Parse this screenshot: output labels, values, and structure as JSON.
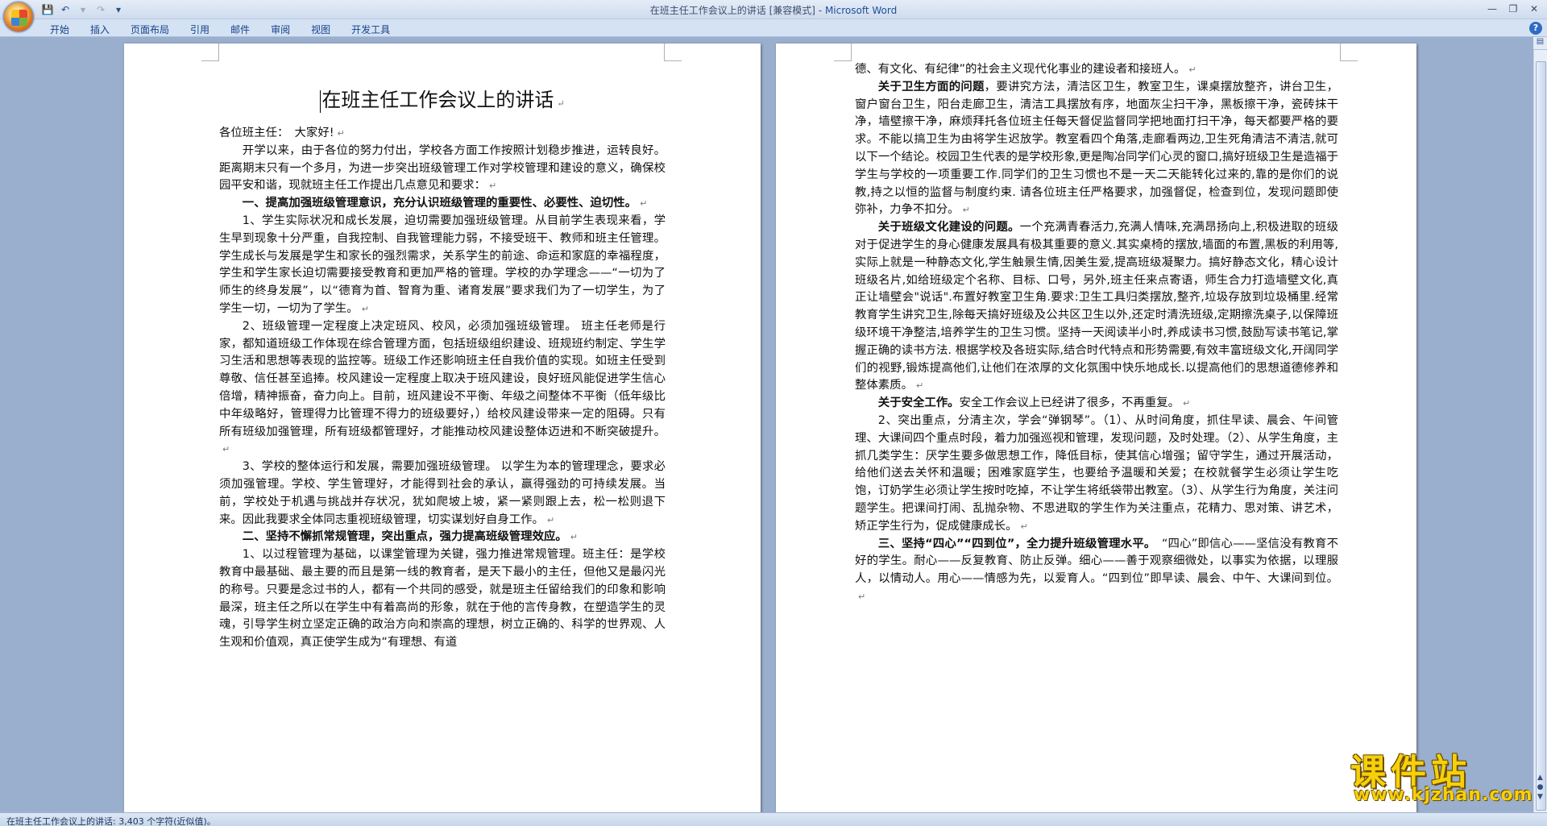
{
  "window": {
    "title_doc": "在班主任工作会议上的讲话 [兼容模式]",
    "title_sep": " - ",
    "title_app": "Microsoft Word"
  },
  "quick_access": {
    "icons": [
      "save-icon",
      "undo-icon",
      "redo-icon",
      "customize-icon"
    ]
  },
  "ribbon": {
    "tabs": [
      "开始",
      "插入",
      "页面布局",
      "引用",
      "邮件",
      "审阅",
      "视图",
      "开发工具"
    ]
  },
  "document": {
    "title": "在班主任工作会议上的讲话",
    "left_page": [
      {
        "type": "plain",
        "text": "各位班主任：　大家好!"
      },
      {
        "type": "ind",
        "text": "开学以来，由于各位的努力付出，学校各方面工作按照计划稳步推进，运转良好。距离期末只有一个多月，为进一步突出班级管理工作对学校管理和建设的意义，确保校园平安和谐，现就班主任工作提出几点意见和要求："
      },
      {
        "type": "ind",
        "bold": true,
        "text": "一、提高加强班级管理意识，充分认识班级管理的重要性、必要性、迫切性。"
      },
      {
        "type": "ind",
        "text": "1、学生实际状况和成长发展，迫切需要加强班级管理。从目前学生表现来看，学生早到现象十分严重，自我控制、自我管理能力弱，不接受班干、教师和班主任管理。学生成长与发展是学生和家长的强烈需求，关系学生的前途、命运和家庭的幸福程度，学生和学生家长迫切需要接受教育和更加严格的管理。学校的办学理念——“一切为了师生的终身发展”，以“德育为首、智育为重、诸育发展”要求我们为了一切学生，为了学生一切，一切为了学生。"
      },
      {
        "type": "ind",
        "text": "2、班级管理一定程度上决定班风、校风，必须加强班级管理。 班主任老师是行家，都知道班级工作体现在综合管理方面，包括班级组织建设、班规班约制定、学生学习生活和思想等表现的监控等。班级工作还影响班主任自我价值的实现。如班主任受到尊敬、信任甚至追捧。校风建设一定程度上取决于班风建设，良好班风能促进学生信心倍增，精神振奋，奋力向上。目前，班风建设不平衡、年级之间整体不平衡（低年级比中年级略好，管理得力比管理不得力的班级要好，）给校风建设带来一定的阻碍。只有所有班级加强管理，所有班级都管理好，才能推动校风建设整体迈进和不断突破提升。"
      },
      {
        "type": "ind",
        "text": "3、学校的整体运行和发展，需要加强班级管理。 以学生为本的管理理念，要求必须加强管理。学校、学生管理好，才能得到社会的承认，赢得强劲的可持续发展。当前，学校处于机遇与挑战并存状况，犹如爬坡上坡，紧一紧则跟上去，松一松则退下来。因此我要求全体同志重视班级管理，切实谋划好自身工作。"
      },
      {
        "type": "ind",
        "bold": true,
        "text": "二、坚持不懈抓常规管理，突出重点，强力提高班级管理效应。"
      },
      {
        "type": "ind",
        "nomark": true,
        "text": "1、以过程管理为基础，以课堂管理为关键，强力推进常规管理。班主任：是学校教育中最基础、最主要的而且是第一线的教育者，是天下最小的主任，但他又是最闪光的称号。只要是念过书的人，都有一个共同的感受，就是班主任留给我们的印象和影响最深，班主任之所以在学生中有着高尚的形象，就在于他的言传身教，在塑造学生的灵魂，引导学生树立坚定正确的政治方向和崇高的理想，树立正确的、科学的世界观、人生观和价值观，真正使学生成为“有理想、有道"
      }
    ],
    "right_page": [
      {
        "type": "plain",
        "text": "德、有文化、有纪律”的社会主义现代化事业的建设者和接班人。"
      },
      {
        "type": "ind",
        "lead": "关于卫生方面的问题",
        "text": "，要讲究方法，清洁区卫生，教室卫生，课桌摆放整齐，讲台卫生，窗户窗台卫生，阳台走廊卫生，清洁工具摆放有序，地面灰尘扫干净，黑板擦干净，瓷砖抹干净，墙壁擦干净，麻烦拜托各位班主任每天督促监督同学把地面打扫干净，每天都要严格的要求。不能以搞卫生为由将学生迟放学。教室看四个角落,走廊看两边,卫生死角清洁不清洁,就可以下一个结论。校园卫生代表的是学校形象,更是陶冶同学们心灵的窗口,搞好班级卫生是造福于学生与学校的一项重要工作.同学们的卫生习惯也不是一天二天能转化过来的,靠的是你们的说教,持之以恒的监督与制度约束. 请各位班主任严格要求，加强督促，检查到位，发现问题即使弥补，力争不扣分。"
      },
      {
        "type": "ind",
        "lead": "关于班级文化建设的问题。",
        "text": "一个充满青春活力,充满人情味,充满昂扬向上,积极进取的班级对于促进学生的身心健康发展具有极其重要的意义.其实桌椅的摆放,墙面的布置,黑板的利用等,实际上就是一种静态文化,学生触景生情,因美生爱,提高班级凝聚力。搞好静态文化，精心设计班级名片,如给班级定个名称、目标、口号，另外,班主任来点寄语，师生合力打造墙壁文化,真正让墙壁会\"说话\".布置好教室卫生角.要求:卫生工具归类摆放,整齐,垃圾存放到垃圾桶里.经常教育学生讲究卫生,除每天搞好班级及公共区卫生以外,还定时清洗班级,定期擦洗桌子,以保障班级环境干净整洁,培养学生的卫生习惯。坚持一天阅读半小时,养成读书习惯,鼓励写读书笔记,掌握正确的读书方法. 根据学校及各班实际,结合时代特点和形势需要,有效丰富班级文化,开阔同学们的视野,锻炼提高他们,让他们在浓厚的文化氛围中快乐地成长.以提高他们的思想道德修养和整体素质。"
      },
      {
        "type": "ind",
        "lead": "关于安全工作。",
        "text": "安全工作会议上已经讲了很多，不再重复。"
      },
      {
        "type": "ind",
        "text": "2、突出重点，分清主次，学会“弹钢琴”。（1）、从时间角度，抓住早读、晨会、午间管理、大课间四个重点时段，着力加强巡视和管理，发现问题，及时处理。（2）、从学生角度，主抓几类学生：厌学生要多做思想工作，降低目标，使其信心增强；留守学生，通过开展活动，给他们送去关怀和温暖；困难家庭学生，也要给予温暖和关爱；在校就餐学生必须让学生吃饱，订奶学生必须让学生按时吃掉，不让学生将纸袋带出教室。（3）、从学生行为角度，关注问题学生。把课间打闹、乱抛杂物、不思进取的学生作为关注重点，花精力、思对策、讲艺术，矫正学生行为，促成健康成长。"
      },
      {
        "type": "ind",
        "lead": "三、坚持“四心”“四到位”，全力提升班级管理水平。",
        "text": "　“四心”即信心——坚信没有教育不好的学生。耐心——反复教育、防止反弹。细心——善于观察细微处，以事实为依据，以理服人，以情动人。用心——情感为先，以爱育人。“四到位”即早读、晨会、中午、大课间到位。"
      }
    ]
  },
  "status": {
    "text": "在班主任工作会议上的讲话: 3,403 个字符(近似值)。"
  },
  "watermark": {
    "main": "课件站",
    "url": "www.kjzhan.com"
  },
  "colors": {
    "title_app": "#1f4f96",
    "ribbon_tab": "#15428b",
    "workspace": "#9aaecd",
    "watermark": "#f6d10a"
  }
}
